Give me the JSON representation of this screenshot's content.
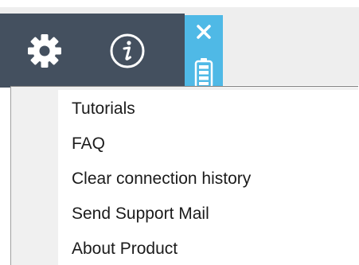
{
  "toolbar": {
    "settings_icon": "gear-icon",
    "info_icon": "info-icon",
    "close_icon": "close-icon",
    "battery_icon": "battery-icon",
    "accent_color": "#4fb9e6",
    "toolbar_color": "#44505f"
  },
  "menu": {
    "items": [
      {
        "label": "Tutorials"
      },
      {
        "label": "FAQ"
      },
      {
        "label": "Clear connection history"
      },
      {
        "label": "Send Support Mail"
      },
      {
        "label": "About Product"
      }
    ]
  }
}
